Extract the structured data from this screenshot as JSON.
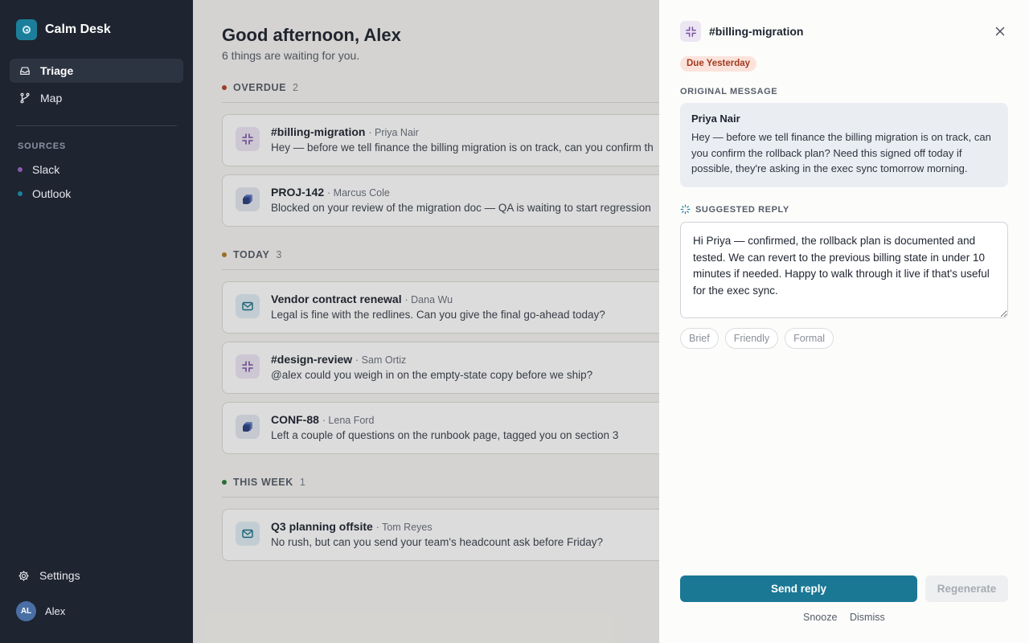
{
  "app": {
    "name": "Calm Desk"
  },
  "nav": {
    "items": [
      {
        "label": "Triage",
        "icon": "inbox-icon",
        "active": true
      },
      {
        "label": "Map",
        "icon": "branch-icon",
        "active": false
      }
    ]
  },
  "sources": {
    "heading": "SOURCES",
    "items": [
      {
        "label": "Slack",
        "color": "#8a5bb0"
      },
      {
        "label": "Outlook",
        "color": "#1b7f9b"
      }
    ]
  },
  "footer": {
    "settings_label": "Settings",
    "user_name": "Alex",
    "user_initials": "AL"
  },
  "main": {
    "greeting": "Good afternoon, Alex",
    "subtitle": "6 things are waiting for you.",
    "groups": [
      {
        "label": "OVERDUE",
        "count": "2",
        "color": "#b0432a",
        "items": [
          {
            "title": "#billing-migration",
            "who": "· Priya Nair",
            "preview": "Hey — before we tell finance the billing migration is on track, can you confirm th",
            "icon": "slack-icon"
          },
          {
            "title": "PROJ-142",
            "who": "· Marcus Cole",
            "preview": "Blocked on your review of the migration doc — QA is waiting to start regression",
            "icon": "jira-icon"
          }
        ]
      },
      {
        "label": "TODAY",
        "count": "3",
        "color": "#b07b2a",
        "items": [
          {
            "title": "Vendor contract renewal",
            "who": "· Dana Wu",
            "preview": "Legal is fine with the redlines. Can you give the final go-ahead today?",
            "icon": "mail-icon"
          },
          {
            "title": "#design-review",
            "who": "· Sam Ortiz",
            "preview": "@alex could you weigh in on the empty-state copy before we ship?",
            "icon": "slack-icon"
          },
          {
            "title": "CONF-88",
            "who": "· Lena Ford",
            "preview": "Left a couple of questions on the runbook page, tagged you on section 3",
            "icon": "jira-icon"
          }
        ]
      },
      {
        "label": "THIS WEEK",
        "count": "1",
        "color": "#2f7a3c",
        "items": [
          {
            "title": "Q3 planning offsite",
            "who": "· Tom Reyes",
            "preview": "No rush, but can you send your team's headcount ask before Friday?",
            "icon": "mail-icon"
          }
        ]
      }
    ]
  },
  "drawer": {
    "title": "#billing-migration",
    "due": "Due Yesterday",
    "original_label": "ORIGINAL MESSAGE",
    "original_sender": "Priya Nair",
    "original_text": "Hey — before we tell finance the billing migration is on track, can you confirm the rollback plan? Need this signed off today if possible, they're asking in the exec sync tomorrow morning.",
    "suggested_label": "SUGGESTED REPLY",
    "reply_text": "Hi Priya — confirmed, the rollback plan is documented and tested. We can revert to the previous billing state in under 10 minutes if needed. Happy to walk through it live if that's useful for the exec sync.",
    "tones": [
      "Brief",
      "Friendly",
      "Formal"
    ],
    "send_label": "Send reply",
    "regenerate_label": "Regenerate",
    "snooze_label": "Snooze",
    "dismiss_label": "Dismiss"
  }
}
